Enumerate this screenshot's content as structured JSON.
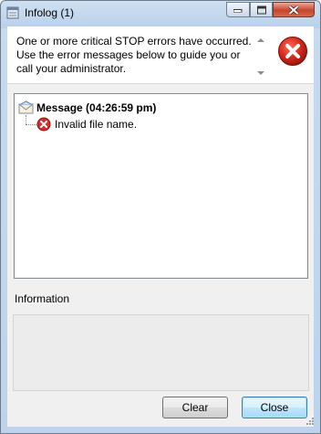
{
  "window": {
    "title": "Infolog (1)",
    "icon": "infolog-app-icon"
  },
  "header": {
    "message_lines": [
      "One or more critical STOP errors have occurred.",
      "Use the error messages below to guide you or",
      "call your administrator."
    ],
    "icon": "stop-error-icon"
  },
  "tree": {
    "parent": {
      "label": "Message (04:26:59 pm)",
      "icon": "message-envelope-icon"
    },
    "children": [
      {
        "label": "Invalid file name.",
        "icon": "error-icon"
      }
    ]
  },
  "info": {
    "label": "Information",
    "value": ""
  },
  "buttons": {
    "clear": "Clear",
    "close": "Close"
  },
  "colors": {
    "error_red": "#d32f2f",
    "titlebar": "#bcd3eb",
    "close_button_accent": "#3c7fb1"
  }
}
